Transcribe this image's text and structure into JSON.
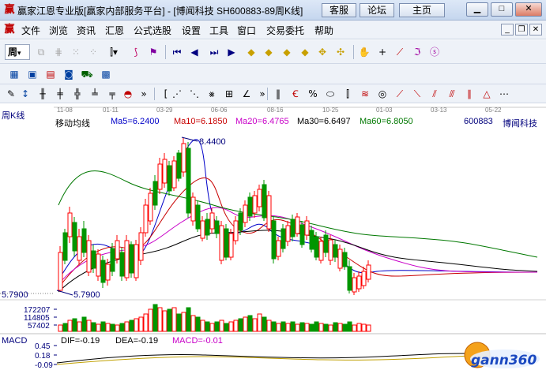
{
  "window": {
    "title": "赢家江恩专业版[赢家内部服务平台] - [博闻科技  SH600883-89周K线]",
    "buttons": {
      "customer_service": "客服",
      "forum": "论坛",
      "home": "主页"
    }
  },
  "menu": {
    "items": [
      "文件",
      "浏览",
      "资讯",
      "汇恩",
      "公式选股",
      "设置",
      "工具",
      "窗口",
      "交易委托",
      "帮助"
    ]
  },
  "toolbar": {
    "period_label": "周",
    "period_arrow": "▾"
  },
  "chart": {
    "panel_label": "周K线",
    "indicator_name": "移动均线",
    "stock_code": "600883",
    "stock_name": "博闻科技",
    "high_annotation": "8.4400",
    "low_annotation": "5.7900",
    "left_price_label": "5.7900",
    "date_labels": [
      "11-08",
      "01-11",
      "03-29",
      "06-06",
      "08-16",
      "10-25",
      "01-03",
      "03-13",
      "05-22"
    ],
    "ma": [
      {
        "name": "Ma5",
        "text": "Ma5=6.2400",
        "color": "#0000c8"
      },
      {
        "name": "Ma10",
        "text": "Ma10=6.1850",
        "color": "#c80000"
      },
      {
        "name": "Ma20",
        "text": "Ma20=6.4765",
        "color": "#c800c8"
      },
      {
        "name": "Ma30",
        "text": "Ma30=6.6497",
        "color": "#000000"
      },
      {
        "name": "Ma60",
        "text": "Ma60=6.8050",
        "color": "#007800"
      }
    ],
    "volume_axis": [
      "172207",
      "114805",
      "57402"
    ]
  },
  "macd": {
    "label": "MACD",
    "dif": "DIF=-0.19",
    "dea": "DEA=-0.19",
    "macd": "MACD=-0.01",
    "axis": [
      "0.45",
      "0.18",
      "-0.09"
    ]
  },
  "watermark": {
    "text": "gann360"
  },
  "colors": {
    "up": "#ff0000",
    "down": "#009600",
    "blue_text": "#00007c"
  }
}
